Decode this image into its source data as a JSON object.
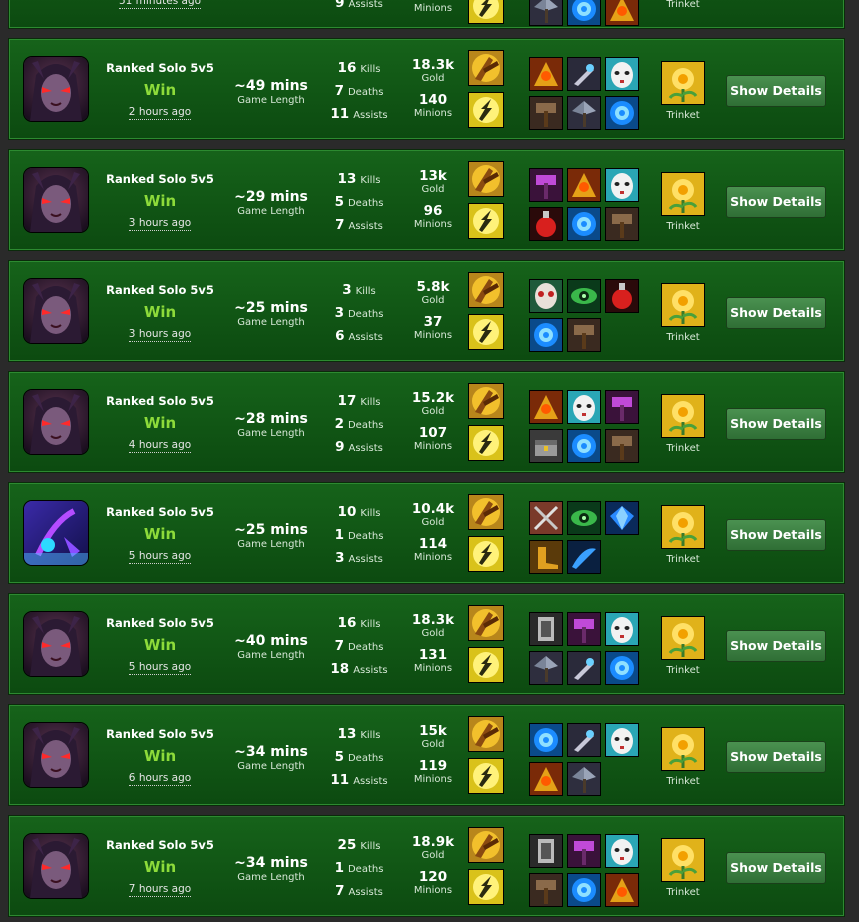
{
  "labels": {
    "kills": "Kills",
    "deaths": "Deaths",
    "assists": "Assists",
    "gold": "Gold",
    "minions": "Minions",
    "game_length": "Game Length",
    "trinket": "Trinket",
    "show_details": "Show Details"
  },
  "top_partial": {
    "ago": "51 minutes ago",
    "assists": "9",
    "minions_label": "Minions"
  },
  "matches": [
    {
      "champion": "evelynn-portrait-icon",
      "queue": "Ranked Solo 5v5",
      "result": "Win",
      "ago": "2 hours ago",
      "length": "~49 mins",
      "kills": "16",
      "deaths": "7",
      "assists": "11",
      "gold": "18.3k",
      "minions": "140",
      "spells": [
        "smite-icon",
        "flash-icon"
      ],
      "items": [
        "trinity-force-icon",
        "sword-guard-icon",
        "mask-icon",
        "hammer-icon",
        "axe-icon",
        "shield-rune-icon"
      ]
    },
    {
      "champion": "evelynn-portrait-icon",
      "queue": "Ranked Solo 5v5",
      "result": "Win",
      "ago": "3 hours ago",
      "length": "~29 mins",
      "kills": "13",
      "deaths": "5",
      "assists": "7",
      "gold": "13k",
      "minions": "96",
      "spells": [
        "smite-icon",
        "flash-icon"
      ],
      "items": [
        "purple-hammer-icon",
        "trinity-force-icon",
        "mask-icon",
        "red-potion-icon",
        "shield-rune-icon",
        "hammer-icon"
      ]
    },
    {
      "champion": "evelynn-portrait-icon",
      "queue": "Ranked Solo 5v5",
      "result": "Win",
      "ago": "3 hours ago",
      "length": "~25 mins",
      "kills": "3",
      "deaths": "3",
      "assists": "6",
      "gold": "5.8k",
      "minions": "37",
      "spells": [
        "smite-icon",
        "flash-icon"
      ],
      "items": [
        "skull-mask-icon",
        "green-eye-icon",
        "red-potion-icon",
        "shield-rune-icon",
        "hammer-icon"
      ]
    },
    {
      "champion": "evelynn-portrait-icon",
      "queue": "Ranked Solo 5v5",
      "result": "Win",
      "ago": "4 hours ago",
      "length": "~28 mins",
      "kills": "17",
      "deaths": "2",
      "assists": "9",
      "gold": "15.2k",
      "minions": "107",
      "spells": [
        "smite-icon",
        "flash-icon"
      ],
      "items": [
        "trinity-force-icon",
        "mask-icon",
        "purple-hammer-icon",
        "chest-icon",
        "shield-rune-icon",
        "hammer-icon"
      ]
    },
    {
      "champion": "alt-champion-portrait-icon",
      "queue": "Ranked Solo 5v5",
      "result": "Win",
      "ago": "5 hours ago",
      "length": "~25 mins",
      "kills": "10",
      "deaths": "1",
      "assists": "3",
      "gold": "10.4k",
      "minions": "114",
      "spells": [
        "smite-icon",
        "flash-icon"
      ],
      "items": [
        "crossed-swords-icon",
        "green-eye-icon",
        "blue-gem-icon",
        "gold-boots-icon",
        "blue-blade-icon"
      ]
    },
    {
      "champion": "evelynn-portrait-icon",
      "queue": "Ranked Solo 5v5",
      "result": "Win",
      "ago": "5 hours ago",
      "length": "~40 mins",
      "kills": "16",
      "deaths": "7",
      "assists": "18",
      "gold": "18.3k",
      "minions": "131",
      "spells": [
        "smite-icon",
        "flash-icon"
      ],
      "items": [
        "armor-card-icon",
        "purple-hammer-icon",
        "mask-icon",
        "axe-icon",
        "sword-guard-icon",
        "shield-rune-icon"
      ]
    },
    {
      "champion": "evelynn-portrait-icon",
      "queue": "Ranked Solo 5v5",
      "result": "Win",
      "ago": "6 hours ago",
      "length": "~34 mins",
      "kills": "13",
      "deaths": "5",
      "assists": "11",
      "gold": "15k",
      "minions": "119",
      "spells": [
        "smite-icon",
        "flash-icon"
      ],
      "items": [
        "shield-rune-icon",
        "sword-guard-icon",
        "mask-icon",
        "trinity-force-icon",
        "axe-icon"
      ]
    },
    {
      "champion": "evelynn-portrait-icon",
      "queue": "Ranked Solo 5v5",
      "result": "Win",
      "ago": "7 hours ago",
      "length": "~34 mins",
      "kills": "25",
      "deaths": "1",
      "assists": "7",
      "gold": "18.9k",
      "minions": "120",
      "spells": [
        "smite-icon",
        "flash-icon"
      ],
      "items": [
        "armor-card-icon",
        "purple-hammer-icon",
        "mask-icon",
        "hammer-icon",
        "shield-rune-icon",
        "trinity-force-icon"
      ]
    }
  ],
  "colors": {
    "row_bg": "#145c18",
    "win": "#8ddb3a",
    "button": "#3e8446"
  }
}
